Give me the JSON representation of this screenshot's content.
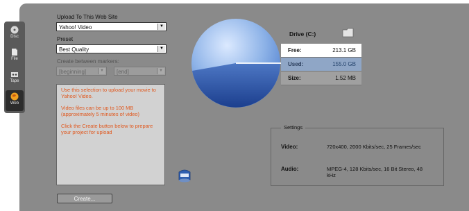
{
  "sidebar": {
    "tabs": [
      {
        "label": "Disc",
        "icon": "disc-icon"
      },
      {
        "label": "File",
        "icon": "file-icon"
      },
      {
        "label": "Tape",
        "icon": "tape-icon"
      },
      {
        "label": "Web",
        "icon": "globe-icon"
      }
    ],
    "active": "Web"
  },
  "upload": {
    "site_label": "Upload To This Web Site",
    "site_value": "Yahoo! Video",
    "preset_label": "Preset",
    "preset_value": "Best Quality",
    "markers_label": "Create between markers:",
    "marker_start": "[beginning]",
    "marker_end": "[end]"
  },
  "info": {
    "p1": "Use this selection to upload your movie to Yahoo! Video.",
    "p2": "Video files can be up to 100 MB (approximately 5 minutes of video)",
    "p3": "Click the Create button below to prepare your project for upload"
  },
  "create_button": "Create...",
  "drive": {
    "label": "Drive (C:)",
    "free_label": "Free:",
    "free_value": "213.1 GB",
    "used_label": "Used:",
    "used_value": "155.0 GB",
    "size_label": "Size:",
    "size_value": "1.52 MB"
  },
  "settings": {
    "caption": "Settings",
    "video_label": "Video:",
    "video_value": "720x400, 2000 Kbits/sec, 25 Frames/sec",
    "audio_label": "Audio:",
    "audio_value": "MPEG-4, 128 Kbits/sec, 16 Bit Stereo, 48 kHz"
  },
  "colors": {
    "panel": "#8a8a8a",
    "info_text": "#e0581e",
    "used_row": "#8fa6c6",
    "pie_top": "#8fb4e8",
    "pie_bottom": "#1f4fa8"
  }
}
